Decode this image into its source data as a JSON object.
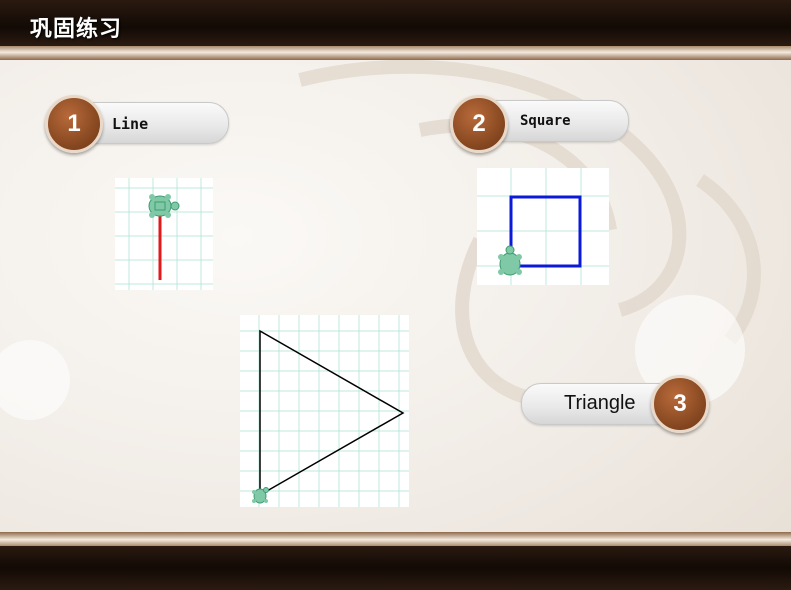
{
  "header": {
    "title": "巩固练习"
  },
  "items": [
    {
      "number": "1",
      "label": "Line"
    },
    {
      "number": "2",
      "label": "Square"
    },
    {
      "number": "3",
      "label": "Triangle"
    }
  ],
  "colors": {
    "line": "#e0191b",
    "square": "#0b19d9",
    "triangle": "#000000",
    "grid": "#bfe7df",
    "badge": "#8a4a22"
  },
  "icons": {
    "turtle": "turtle-icon"
  }
}
